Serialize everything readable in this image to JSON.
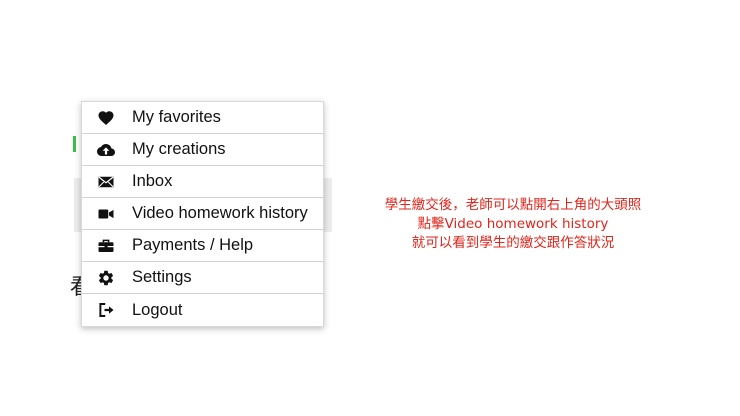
{
  "menu": {
    "items": [
      {
        "label": "My favorites",
        "icon": "heart-icon"
      },
      {
        "label": "My creations",
        "icon": "cloud-upload-icon"
      },
      {
        "label": "Inbox",
        "icon": "envelope-icon"
      },
      {
        "label": "Video homework history",
        "icon": "video-camera-icon"
      },
      {
        "label": "Payments / Help",
        "icon": "briefcase-icon"
      },
      {
        "label": "Settings",
        "icon": "gear-icon"
      },
      {
        "label": "Logout",
        "icon": "sign-out-icon"
      }
    ]
  },
  "annotation": {
    "lines": [
      "學生繳交後，老師可以點開右上角的大頭照",
      "點擊Video homework history",
      "就可以看到學生的繳交跟作答狀況"
    ],
    "color": "#e0251b"
  },
  "background": {
    "partial_char": "看"
  }
}
